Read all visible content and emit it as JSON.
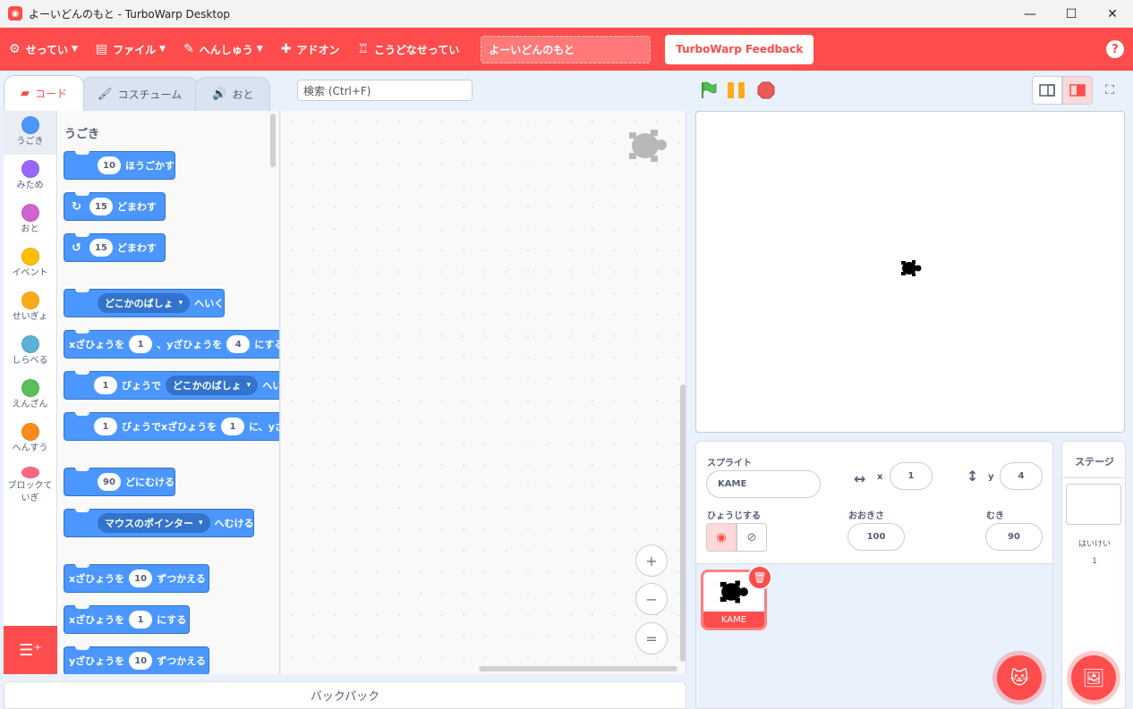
{
  "window": {
    "title": "よーいどんのもと - TurboWarp Desktop",
    "minimize": "—",
    "maximize": "☐",
    "close": "✕"
  },
  "menubar": {
    "items": [
      {
        "label": "せってい",
        "icon": "gear-icon",
        "has_caret": true
      },
      {
        "label": "ファイル",
        "icon": "file-icon",
        "has_caret": true
      },
      {
        "label": "へんしゅう",
        "icon": "pencil-icon",
        "has_caret": true
      },
      {
        "label": "アドオン",
        "icon": "puzzle-icon",
        "has_caret": false
      },
      {
        "label": "こうどなせってい",
        "icon": "trophy-icon",
        "has_caret": false
      }
    ],
    "project_title": "よーいどんのもと",
    "feedback_label": "TurboWarp Feedback",
    "help_label": "?"
  },
  "tabs": [
    {
      "label": "コード",
      "icon": "code-icon",
      "active": true
    },
    {
      "label": "コスチューム",
      "icon": "brush-icon",
      "active": false
    },
    {
      "label": "おと",
      "icon": "speaker-icon",
      "active": false
    }
  ],
  "search": {
    "placeholder": "検索 (Ctrl+F)"
  },
  "categories": [
    {
      "label": "うごき",
      "color": "#4c97ff",
      "active": true
    },
    {
      "label": "みため",
      "color": "#9966ff",
      "active": false
    },
    {
      "label": "おと",
      "color": "#cf63cf",
      "active": false
    },
    {
      "label": "イベント",
      "color": "#ffbf00",
      "active": false
    },
    {
      "label": "せいぎょ",
      "color": "#ffab19",
      "active": false
    },
    {
      "label": "しらべる",
      "color": "#5cb1d6",
      "active": false
    },
    {
      "label": "えんざん",
      "color": "#59c059",
      "active": false
    },
    {
      "label": "へんすう",
      "color": "#ff8c1a",
      "active": false
    },
    {
      "label": "ブロックていぎ",
      "color": "#ff6680",
      "active": false
    }
  ],
  "palette": {
    "heading": "うごき",
    "blocks": {
      "move": {
        "value": "10",
        "text": "ほうごかす"
      },
      "turn_right": {
        "value": "15",
        "text": "どまわす"
      },
      "turn_left": {
        "value": "15",
        "text": "どまわす"
      },
      "goto": {
        "menu": "どこかのばしょ",
        "text": "へいく"
      },
      "goto_xy": {
        "t1": "xざひょうを",
        "x": "1",
        "t2": "、yざひょうを",
        "y": "4",
        "t3": "にする"
      },
      "glide_to": {
        "value": "1",
        "t1": "びょうで",
        "menu": "どこかのばしょ",
        "t2": "へい"
      },
      "glide_xy": {
        "value": "1",
        "t1": "びょうでxざひょうを",
        "x": "1",
        "t2": "に、yざ"
      },
      "point_dir": {
        "value": "90",
        "text": "どにむける"
      },
      "point_towards": {
        "menu": "マウスのポインター",
        "text": "へむける"
      },
      "change_x": {
        "t1": "xざひょうを",
        "value": "10",
        "t2": "ずつかえる"
      },
      "set_x": {
        "t1": "xざひょうを",
        "value": "1",
        "t2": "にする"
      },
      "change_y": {
        "t1": "yざひょうを",
        "value": "10",
        "t2": "ずつかえる"
      }
    }
  },
  "workspace": {
    "zoom_in": "+",
    "zoom_out": "−",
    "zoom_reset": "="
  },
  "backpack_label": "バックパック",
  "sprite_info": {
    "sprite_label": "スプライト",
    "sprite_name": "KAME",
    "x_label": "x",
    "x_value": "1",
    "y_label": "y",
    "y_value": "4",
    "show_label": "ひょうじする",
    "size_label": "おおきさ",
    "size_value": "100",
    "direction_label": "むき",
    "direction_value": "90"
  },
  "sprites": [
    {
      "name": "KAME",
      "selected": true
    }
  ],
  "stage_panel": {
    "title": "ステージ",
    "backdrop_label": "はいけい",
    "backdrop_count": "1"
  },
  "colors": {
    "accent": "#ff4c4c",
    "motion": "#4c97ff"
  }
}
